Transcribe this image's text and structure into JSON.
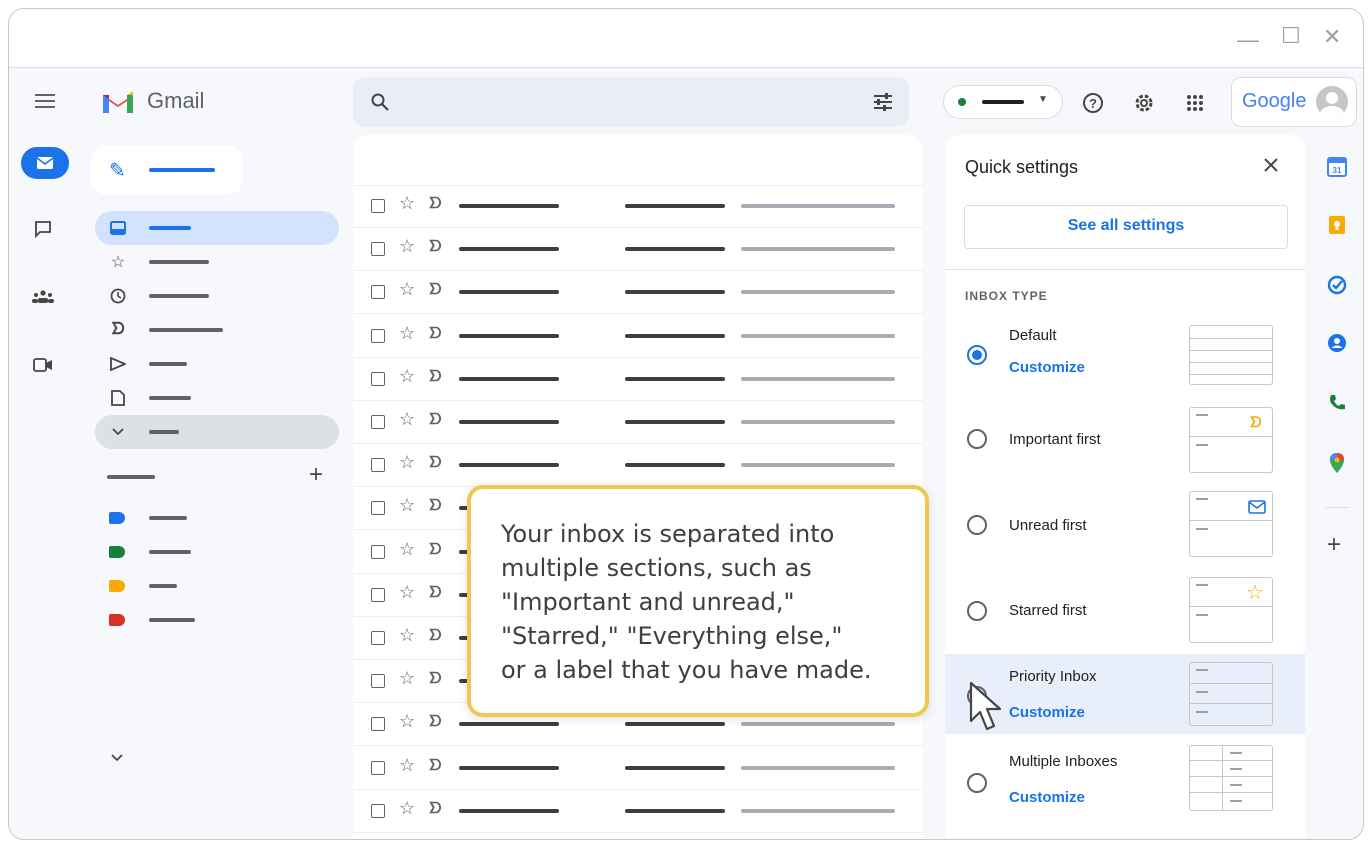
{
  "app": {
    "name": "Gmail",
    "window_controls": [
      "—",
      "☐",
      "✕"
    ]
  },
  "header": {
    "search_icon": "search-icon",
    "filter_icon": "tune-icon",
    "status_dot_color": "#188038",
    "icons": [
      "help-icon",
      "settings-icon",
      "apps-grid-icon"
    ],
    "account_logo": "Google"
  },
  "colors": {
    "accent": "#1a73e8",
    "callout_border": "#f0c850",
    "label_colors": [
      "#1a73e8",
      "#188038",
      "#f9ab00",
      "#d93025"
    ]
  },
  "quick_settings": {
    "title": "Quick settings",
    "see_all_label": "See all settings",
    "section_header": "INBOX TYPE",
    "options": [
      {
        "label": "Default",
        "customize": "Customize",
        "selected": true
      },
      {
        "label": "Important first",
        "customize": "",
        "selected": false
      },
      {
        "label": "Unread first",
        "customize": "",
        "selected": false
      },
      {
        "label": "Starred first",
        "customize": "",
        "selected": false
      },
      {
        "label": "Priority Inbox",
        "customize": "Customize",
        "selected": false
      },
      {
        "label": "Multiple Inboxes",
        "customize": "Customize",
        "selected": false
      }
    ]
  },
  "callout": {
    "text": "Your inbox is separated into\nmultiple sections, such as\n\"Important and unread,\"\n\"Starred,\" \"Everything else,\"\nor a label that you have made."
  }
}
